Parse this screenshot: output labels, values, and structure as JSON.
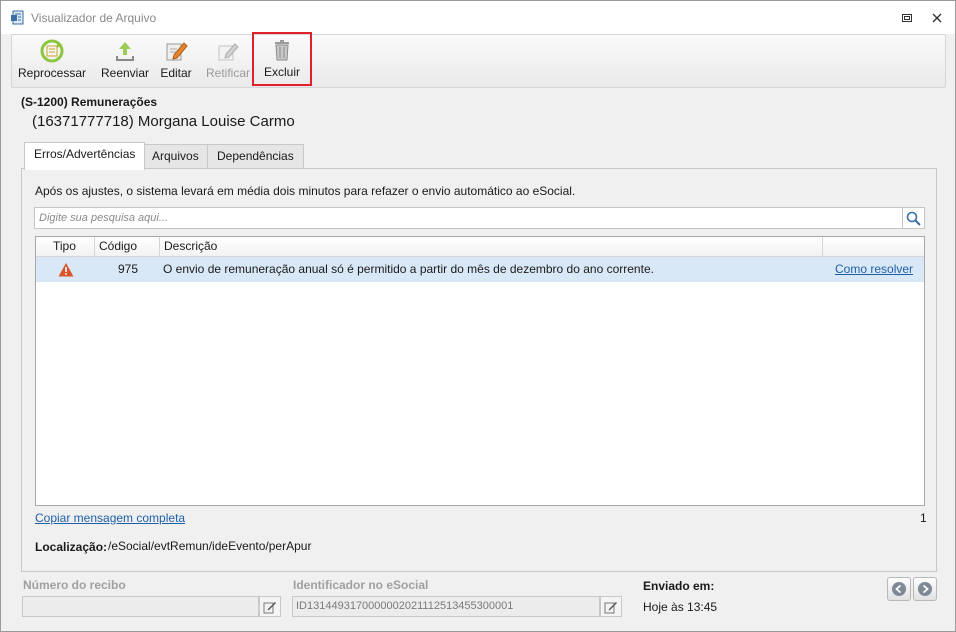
{
  "window": {
    "title": "Visualizador de Arquivo"
  },
  "toolbar": {
    "reprocessar": "Reprocessar",
    "reenviar": "Reenviar",
    "editar": "Editar",
    "retificar": "Retificar",
    "excluir": "Excluir"
  },
  "header": {
    "event": "(S-1200) Remunerações",
    "person": "(16371777718) Morgana Louise Carmo"
  },
  "tabs": [
    {
      "label": "Erros/Advertências",
      "active": true
    },
    {
      "label": "Arquivos",
      "active": false
    },
    {
      "label": "Dependências",
      "active": false
    }
  ],
  "main": {
    "info": "Após os ajustes, o sistema levará em média dois minutos para refazer o envio automático ao eSocial.",
    "search_placeholder": "Digite sua pesquisa aqui...",
    "columns": {
      "tipo": "Tipo",
      "codigo": "Código",
      "descricao": "Descrição"
    },
    "rows": [
      {
        "tipo_icon": "warning-icon",
        "codigo": "975",
        "descricao": "O envio de remuneração anual só é permitido a partir do mês de dezembro do ano corrente.",
        "link": "Como resolver"
      }
    ],
    "copy_link": "Copiar mensagem completa",
    "count": "1",
    "localizacao_label": "Localização:",
    "localizacao_value": "/eSocial/evtRemun/ideEvento/perApur"
  },
  "footer": {
    "recibo_label": "Número do recibo",
    "recibo_value": "",
    "identificador_label": "Identificador no eSocial",
    "identificador_value": "ID1314493170000002021112513455300001",
    "enviado_label": "Enviado em:",
    "enviado_value": "Hoje às 13:45"
  },
  "colors": {
    "highlight_border": "#e0202a",
    "row_selected": "#d9e8f6",
    "link": "#1f5fa8"
  }
}
